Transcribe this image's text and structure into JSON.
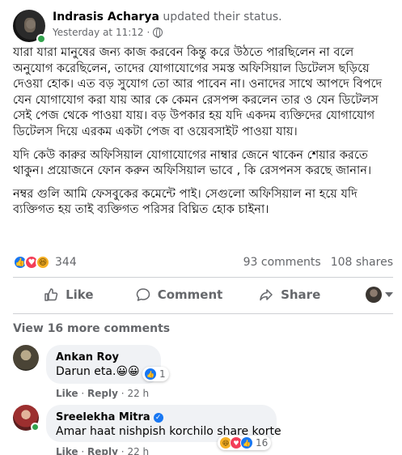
{
  "post": {
    "author": "Indrasis Acharya",
    "action": "updated their status.",
    "time": "Yesterday at 11:12",
    "time_separator": "·",
    "paragraphs": [
      "যারা যারা মানুষের জন্য কাজ করবেন কিন্তু করে উঠতে পারছিলেন না বলে অনুযোগ করেছিলেন, তাদের  যোগাযোগের সমস্ত অফিসিয়াল ডিটেলস ছড়িয়ে দেওয়া হোক। এত বড় সুযোগ তো আর পাবেন না। ওনাদের সাথে আপদে বিপদে যেন যোগাযোগ করা যায় আর কে কেমন রেসপন্স করলেন তার ও যেন ডিটেলস সেই পেজ থেকে পাওয়া যায়। বড় উপকার হয় যদি একদম ব্যক্তিদের যোগাযোগ ডিটেলস দিয়ে এরকম একটা পেজ বা ওয়েবসাইট পাওয়া যায়।",
      "যদি কেউ কারুর অফিসিয়াল যোগাযোগের নাম্বার জেনে থাকেন শেয়ার করতে থাকুন। প্রয়োজনে ফোন করুন অফিসিয়াল ভাবে , কি রেসপনস করছে জানান।",
      "নম্বর গুলি আমি ফেসবুকের কমেন্টে পাই। সেগুলো অফিসিয়াল না হয়ে যদি ব্যক্তিগত হয় তাই ব্যক্তিগত পরিসর বিঘ্নিত হোক চাইনা।"
    ]
  },
  "reactions": {
    "count": "344",
    "comments": "93 comments",
    "shares": "108 shares",
    "icons": [
      "like-icon",
      "love-icon",
      "haha-icon"
    ]
  },
  "actions": {
    "like": "Like",
    "comment": "Comment",
    "share": "Share"
  },
  "comments_section": {
    "view_more": "View 16 more comments",
    "items": [
      {
        "name": "Ankan Roy",
        "text": "Darun eta.😀😀",
        "react_count": "1",
        "like_label": "Like",
        "reply_label": "Reply",
        "time": "22 h"
      },
      {
        "name": "Sreelekha Mitra",
        "text": "Amar haat nishpish korchilo share korte",
        "react_count": "16",
        "like_label": "Like",
        "reply_label": "Reply",
        "time": "22 h"
      }
    ]
  },
  "colors": {
    "like_blue": "#1877f2",
    "love_red": "#f33e58",
    "haha_yellow": "#f7b125",
    "secondary_text": "#65676b",
    "bubble_bg": "#f0f2f5",
    "online_green": "#31a24c"
  }
}
